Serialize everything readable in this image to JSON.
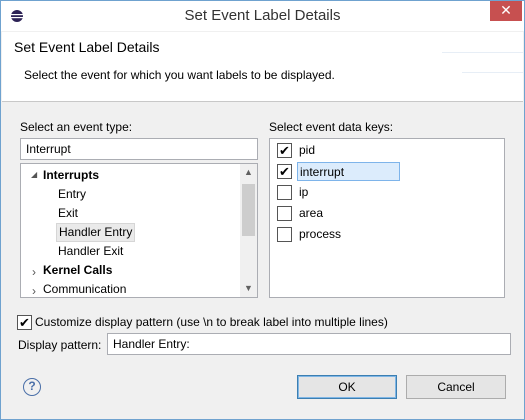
{
  "window": {
    "title": "Set Event Label Details"
  },
  "header": {
    "title": "Set Event Label Details",
    "subtitle": "Select the event for which you want labels to be displayed."
  },
  "event_type": {
    "label": "Select an event type:",
    "filter_value": "Interrupt",
    "tree": [
      {
        "label": "Interrupts",
        "expanded": true,
        "bold": true
      },
      {
        "label": "Entry"
      },
      {
        "label": "Exit"
      },
      {
        "label": "Handler Entry",
        "selected": true
      },
      {
        "label": "Handler Exit"
      },
      {
        "label": "Kernel Calls",
        "expanded": false,
        "bold": true
      },
      {
        "label": "Communication",
        "expanded": false
      }
    ]
  },
  "data_keys": {
    "label": "Select event data keys:",
    "items": [
      {
        "label": "pid",
        "checked": true
      },
      {
        "label": "interrupt",
        "checked": true
      },
      {
        "label": "ip",
        "checked": false
      },
      {
        "label": "area",
        "checked": false
      },
      {
        "label": "process",
        "checked": false
      }
    ]
  },
  "customize": {
    "checked": true,
    "label": "Customize display pattern (use \\n to break label into multiple lines)"
  },
  "pattern": {
    "label": "Display pattern:",
    "value": "Handler Entry:"
  },
  "buttons": {
    "ok": "OK",
    "cancel": "Cancel",
    "close": "✕",
    "help": "?"
  },
  "symbols": {
    "check": "✔",
    "tree_expanded": "◢",
    "tree_collapsed": "›",
    "scroll_up": "▲",
    "scroll_down": "▼"
  }
}
